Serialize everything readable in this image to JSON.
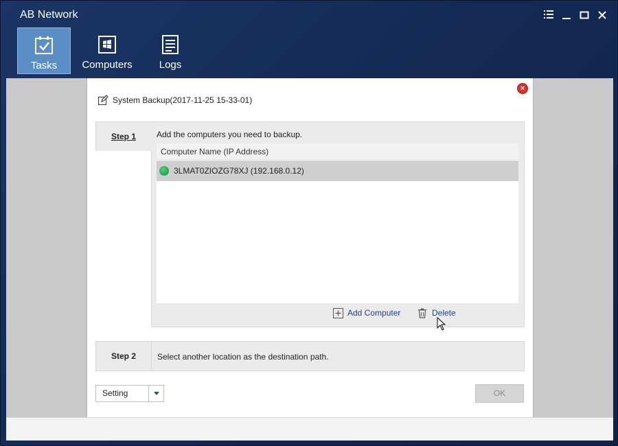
{
  "window": {
    "title": "AB Network",
    "controls": [
      "list-icon",
      "minimize-icon",
      "maximize-icon",
      "close-icon"
    ]
  },
  "nav": {
    "items": [
      {
        "label": "Tasks",
        "icon": "tasks-checkbox-icon",
        "active": true
      },
      {
        "label": "Computers",
        "icon": "computers-windows-icon",
        "active": false
      },
      {
        "label": "Logs",
        "icon": "logs-document-icon",
        "active": false
      }
    ]
  },
  "task": {
    "title": "System Backup(2017-11-25 15-33-01)",
    "close_icon": "close-circle-icon"
  },
  "step1": {
    "label": "Step 1",
    "description": "Add the computers you need to backup.",
    "list": {
      "header": "Computer Name (IP Address)",
      "rows": [
        {
          "name": "3LMAT0ZIOZG78XJ (192.168.0.12)",
          "status": "online",
          "status_color": "#23a449"
        }
      ]
    },
    "add_label": "Add Computer",
    "delete_label": "Delete"
  },
  "step2": {
    "label": "Step 2",
    "description": "Select another location as the destination path."
  },
  "footer": {
    "setting_label": "Setting",
    "ok_label": "OK"
  },
  "colors": {
    "titlebar": "#1b3566",
    "active_tab": "#5b8ec4",
    "link": "#1f3f8c",
    "close_red": "#d9302c"
  }
}
